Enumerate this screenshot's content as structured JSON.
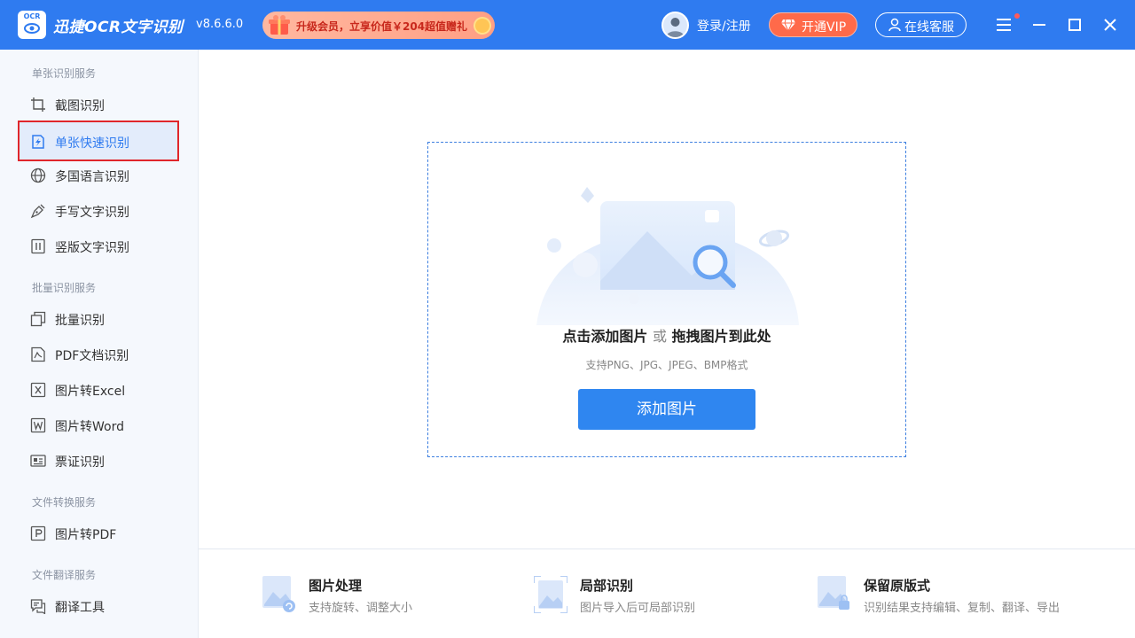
{
  "titlebar": {
    "logo_text": "OCR",
    "app_name": "迅捷OCR文字识别",
    "version": "v8.6.6.0",
    "promo_text": "升级会员，立享价值￥204超值赠礼",
    "login_label": "登录/注册",
    "vip_label": "开通VIP",
    "service_label": "在线客服",
    "accent_color": "#2f7bf0"
  },
  "sidebar": {
    "sections": [
      {
        "label": "单张识别服务",
        "items": [
          {
            "label": "截图识别",
            "icon": "crop-icon"
          },
          {
            "label": "单张快速识别",
            "icon": "quick-scan-icon",
            "active": true
          },
          {
            "label": "多国语言识别",
            "icon": "globe-icon"
          },
          {
            "label": "手写文字识别",
            "icon": "pen-icon"
          },
          {
            "label": "竖版文字识别",
            "icon": "vertical-text-icon"
          }
        ]
      },
      {
        "label": "批量识别服务",
        "items": [
          {
            "label": "批量识别",
            "icon": "batch-icon"
          },
          {
            "label": "PDF文档识别",
            "icon": "pdf-icon"
          },
          {
            "label": "图片转Excel",
            "icon": "excel-icon"
          },
          {
            "label": "图片转Word",
            "icon": "word-icon"
          },
          {
            "label": "票证识别",
            "icon": "ticket-icon"
          }
        ]
      },
      {
        "label": "文件转换服务",
        "items": [
          {
            "label": "图片转PDF",
            "icon": "image-to-pdf-icon"
          }
        ]
      },
      {
        "label": "文件翻译服务",
        "items": [
          {
            "label": "翻译工具",
            "icon": "translate-icon"
          }
        ]
      }
    ]
  },
  "main": {
    "drop_title_part1": "点击添加图片",
    "drop_title_or": "或",
    "drop_title_part2": "拖拽图片到此处",
    "drop_subtitle": "支持PNG、JPG、JPEG、BMP格式",
    "add_button": "添加图片"
  },
  "features": [
    {
      "title": "图片处理",
      "desc": "支持旋转、调整大小",
      "icon": "image-process-icon"
    },
    {
      "title": "局部识别",
      "desc": "图片导入后可局部识别",
      "icon": "partial-scan-icon"
    },
    {
      "title": "保留原版式",
      "desc": "识别结果支持编辑、复制、翻译、导出",
      "icon": "keep-layout-icon"
    }
  ]
}
